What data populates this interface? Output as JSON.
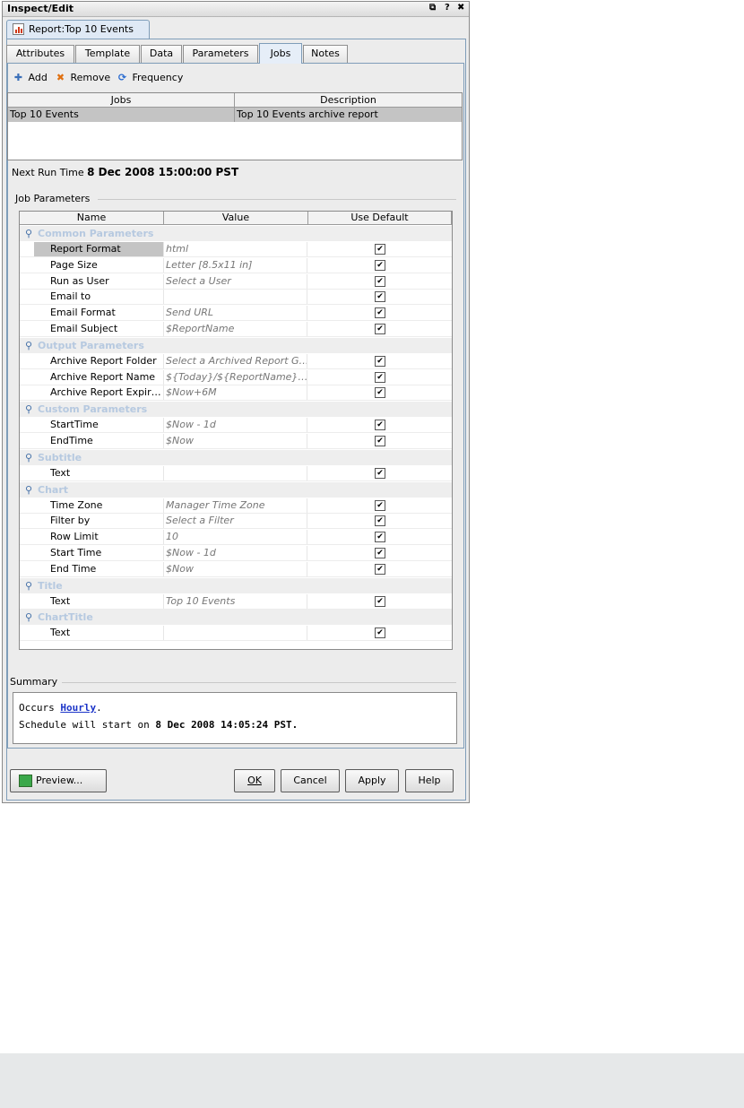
{
  "window": {
    "title": "Inspect/Edit",
    "controls": [
      "⧉",
      "?",
      "✖"
    ]
  },
  "document_tab": {
    "label": "Report:Top 10 Events"
  },
  "tabs": [
    "Attributes",
    "Template",
    "Data",
    "Parameters",
    "Jobs",
    "Notes"
  ],
  "active_tab": "Jobs",
  "toolbar": {
    "add": "Add",
    "remove": "Remove",
    "frequency": "Frequency"
  },
  "jobs_table": {
    "headers": [
      "Jobs",
      "Description"
    ],
    "rows": [
      {
        "job": "Top 10 Events",
        "description": "Top 10 Events archive report"
      }
    ]
  },
  "next_run": {
    "label": "Next Run Time",
    "value": "8 Dec 2008 15:00:00 PST"
  },
  "job_parameters": {
    "title": "Job Parameters",
    "headers": [
      "Name",
      "Value",
      "Use Default"
    ],
    "groups": [
      {
        "name": "Common Parameters",
        "rows": [
          {
            "name": "Report Format",
            "value": "html",
            "default": "✔"
          },
          {
            "name": "Page Size",
            "value": "Letter [8.5x11 in]",
            "default": "✔"
          },
          {
            "name": "Run as User",
            "value": "Select a User",
            "default": "✔"
          },
          {
            "name": "Email to",
            "value": "",
            "default": "✔"
          },
          {
            "name": "Email Format",
            "value": "Send URL",
            "default": "✔"
          },
          {
            "name": "Email Subject",
            "value": "$ReportName",
            "default": "✔"
          }
        ]
      },
      {
        "name": "Output Parameters",
        "rows": [
          {
            "name": "Archive Report Folder",
            "value": "Select a Archived Report G…",
            "default": "✔"
          },
          {
            "name": "Archive Report Name",
            "value": "${Today}/${ReportName}…",
            "default": "✔"
          },
          {
            "name": "Archive Report Expir…",
            "value": "$Now+6M",
            "default": "✔"
          }
        ]
      },
      {
        "name": "Custom Parameters",
        "rows": [
          {
            "name": "StartTime",
            "value": "$Now - 1d",
            "default": "✔"
          },
          {
            "name": "EndTime",
            "value": "$Now",
            "default": "✔"
          }
        ]
      },
      {
        "name": "Subtitle",
        "rows": [
          {
            "name": "Text",
            "value": "",
            "default": "✔"
          }
        ]
      },
      {
        "name": "Chart",
        "rows": [
          {
            "name": "Time Zone",
            "value": "Manager Time Zone",
            "default": "✔"
          },
          {
            "name": "Filter by",
            "value": "Select a Filter",
            "default": "✔"
          },
          {
            "name": "Row Limit",
            "value": "10",
            "default": "✔"
          },
          {
            "name": "Start Time",
            "value": "$Now - 1d",
            "default": "✔"
          },
          {
            "name": "End Time",
            "value": "$Now",
            "default": "✔"
          }
        ]
      },
      {
        "name": "Title",
        "rows": [
          {
            "name": "Text",
            "value": "Top 10 Events",
            "default": "✔"
          }
        ]
      },
      {
        "name": "ChartTitle",
        "rows": [
          {
            "name": "Text",
            "value": "",
            "default": "✔"
          }
        ]
      }
    ]
  },
  "summary": {
    "title": "Summary",
    "occurs_prefix": "Occurs ",
    "occurs_link": "Hourly",
    "occurs_suffix": ".",
    "schedule_prefix": "Schedule will start on ",
    "schedule_value": "8 Dec 2008 14:05:24 PST."
  },
  "buttons": {
    "preview": "Preview...",
    "ok": "OK",
    "cancel": "Cancel",
    "apply": "Apply",
    "help": "Help"
  }
}
